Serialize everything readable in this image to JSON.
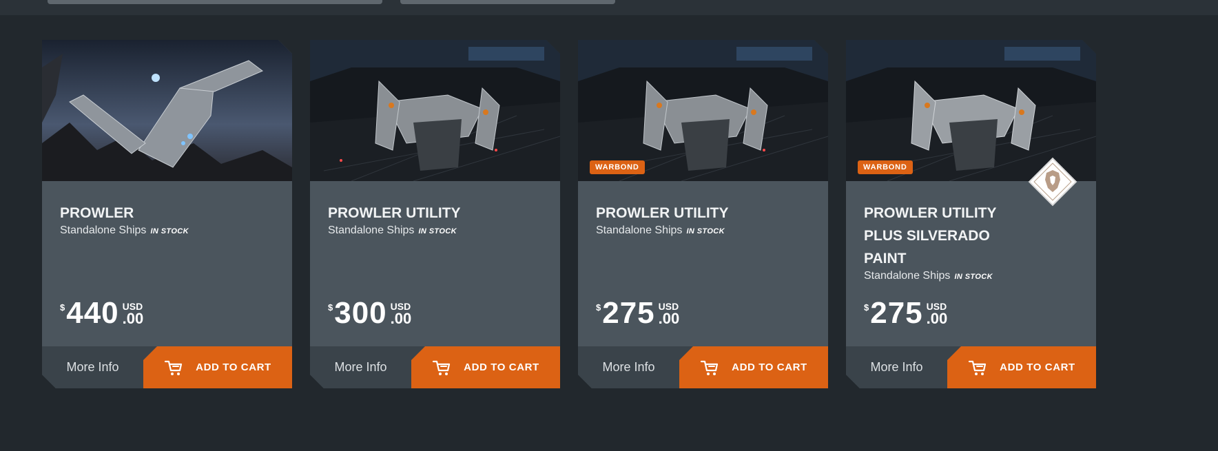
{
  "filters": {
    "tab_a": "",
    "tab_b": ""
  },
  "products": [
    {
      "title": "PROWLER",
      "category": "Standalone Ships",
      "stock": "IN STOCK",
      "currency_symbol": "$",
      "amount": "440",
      "currency": "USD",
      "cents": ".00",
      "badge": "",
      "more_info": "More Info",
      "add_to_cart": "ADD TO CART",
      "image": "prowler-flight-image"
    },
    {
      "title": "PROWLER UTILITY",
      "category": "Standalone Ships",
      "stock": "IN STOCK",
      "currency_symbol": "$",
      "amount": "300",
      "currency": "USD",
      "cents": ".00",
      "badge": "",
      "more_info": "More Info",
      "add_to_cart": "ADD TO CART",
      "image": "prowler-utility-hangar-image"
    },
    {
      "title": "PROWLER UTILITY",
      "category": "Standalone Ships",
      "stock": "IN STOCK",
      "currency_symbol": "$",
      "amount": "275",
      "currency": "USD",
      "cents": ".00",
      "badge": "WARBOND",
      "more_info": "More Info",
      "add_to_cart": "ADD TO CART",
      "image": "prowler-utility-hangar-image"
    },
    {
      "title": "PROWLER UTILITY PLUS SILVERADO PAINT",
      "category": "Standalone Ships",
      "stock": "IN STOCK",
      "currency_symbol": "$",
      "amount": "275",
      "currency": "USD",
      "cents": ".00",
      "badge": "WARBOND",
      "more_info": "More Info",
      "add_to_cart": "ADD TO CART",
      "image": "prowler-utility-hangar-image",
      "emblem": "lion-emblem-icon"
    }
  ],
  "colors": {
    "background": "#22282d",
    "card": "#4b555d",
    "footer": "#3a434a",
    "accent": "#dc6214"
  }
}
